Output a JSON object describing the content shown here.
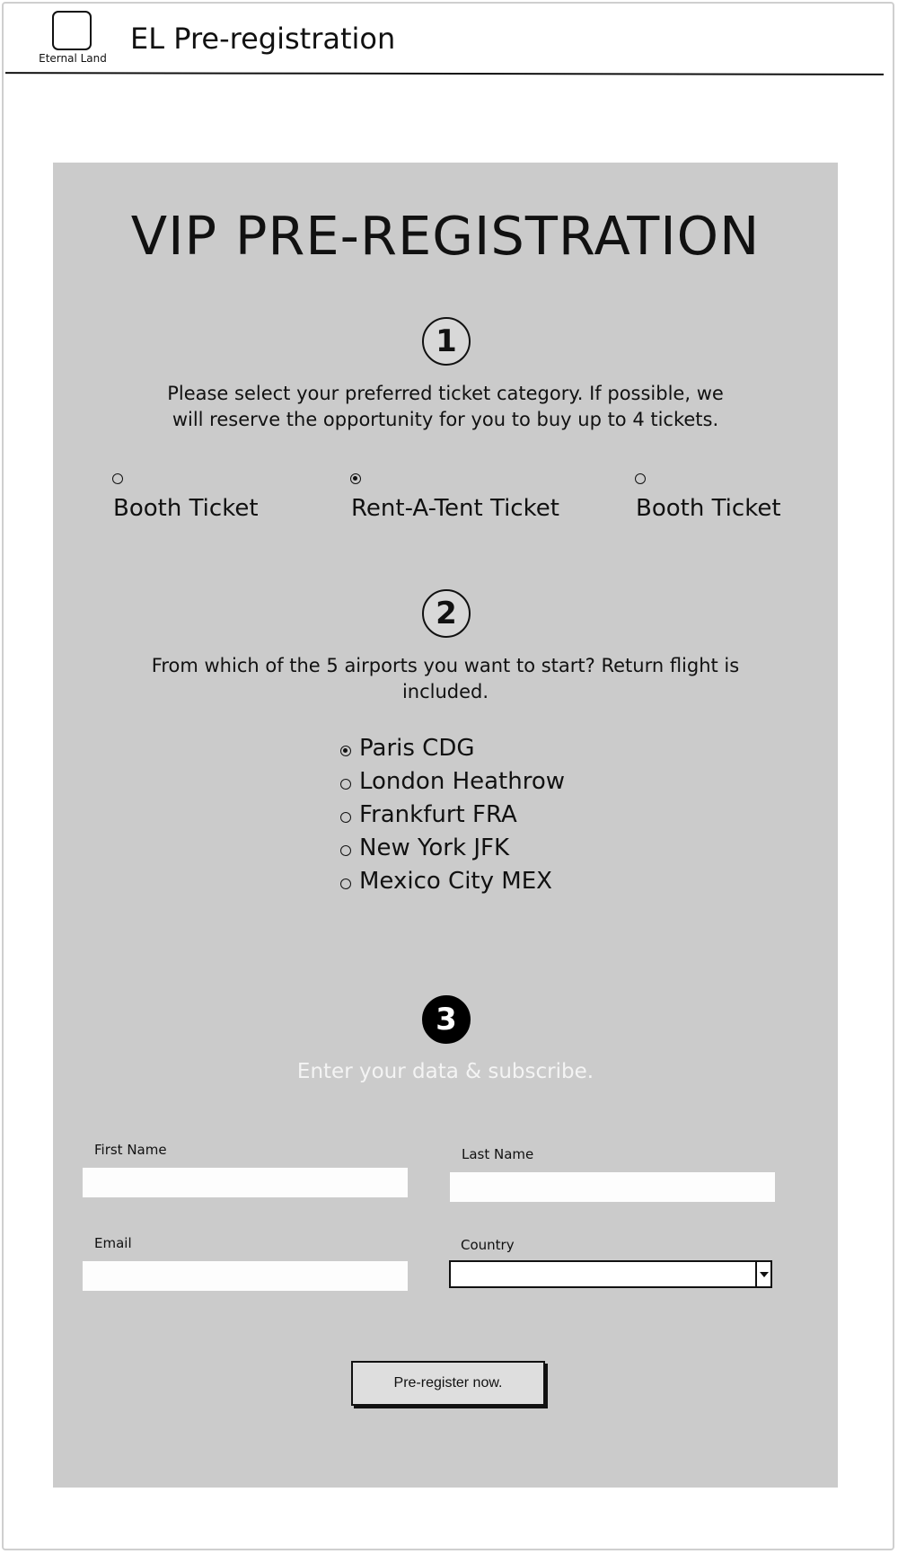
{
  "header": {
    "logo_caption": "Eternal Land",
    "title": "EL Pre-registration"
  },
  "main": {
    "title": "VIP PRE-REGISTRATION",
    "step1": {
      "number": "1",
      "text_line1": "Please select your preferred ticket category. If possible, we",
      "text_line2": "will reserve the opportunity for you to buy up to 4 tickets.",
      "options": [
        {
          "label": "Booth Ticket",
          "selected": false
        },
        {
          "label": "Rent-A-Tent Ticket",
          "selected": true
        },
        {
          "label": "Booth Ticket",
          "selected": false
        }
      ]
    },
    "step2": {
      "number": "2",
      "text_line1": "From which of the 5 airports you want to start? Return flight is",
      "text_line2": "included.",
      "options": [
        {
          "label": "Paris CDG",
          "selected": true
        },
        {
          "label": "London Heathrow",
          "selected": false
        },
        {
          "label": "Frankfurt FRA",
          "selected": false
        },
        {
          "label": "New York JFK",
          "selected": false
        },
        {
          "label": "Mexico City MEX",
          "selected": false
        }
      ]
    },
    "step3": {
      "number": "3",
      "text": "Enter your data & subscribe.",
      "fields": {
        "first_name_label": "First Name",
        "first_name_value": "",
        "last_name_label": "Last Name",
        "last_name_value": "",
        "email_label": "Email",
        "email_value": "",
        "country_label": "Country",
        "country_value": ""
      },
      "submit_label": "Pre-register now."
    }
  },
  "colors": {
    "panel_background": "#cbcbcb",
    "badge_dark": "#000000",
    "subscribe_text": "#f4f4f4"
  }
}
